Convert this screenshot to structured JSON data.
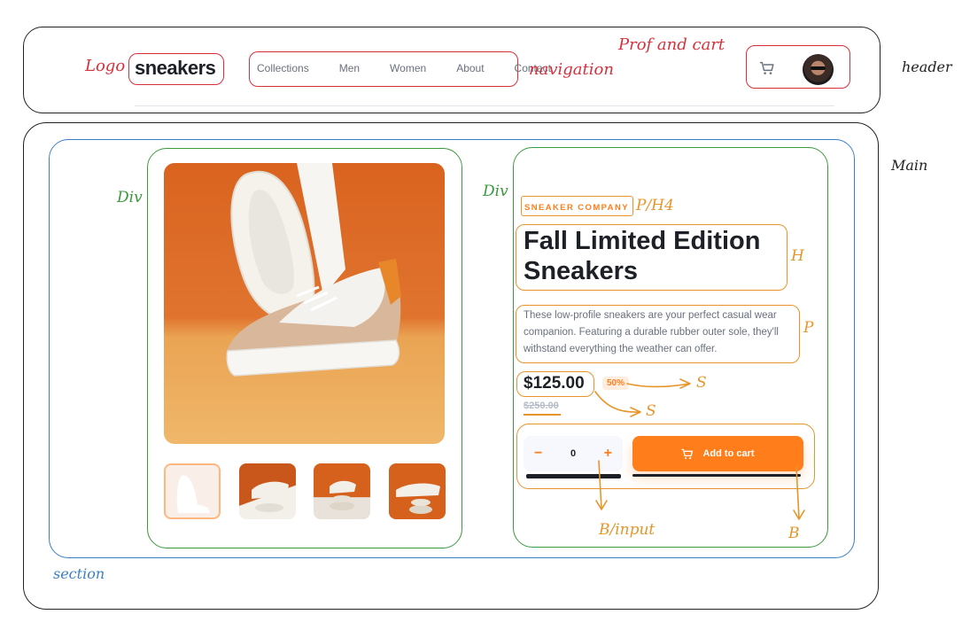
{
  "annotations": {
    "logo": "Logo",
    "navigation": "navigation",
    "prof_and_cart": "Prof and cart",
    "header": "header",
    "main": "Main",
    "section": "section",
    "div_left": "Div",
    "div_right": "Div",
    "p_h4": "P/H4",
    "h": "H",
    "p": "P",
    "s_discount": "S",
    "s_old_price": "S",
    "b_input": "B/input",
    "b": "B"
  },
  "header": {
    "logo": "sneakers",
    "nav": [
      "Collections",
      "Men",
      "Women",
      "About",
      "Contact"
    ],
    "cart_icon": "cart-icon",
    "avatar": "avatar"
  },
  "product": {
    "company": "SNEAKER COMPANY",
    "title": "Fall Limited Edition Sneakers",
    "description": "These low-profile sneakers are your perfect casual wear companion. Featuring a durable rubber outer sole, they'll withstand everything the weather can offer.",
    "price": "$125.00",
    "discount": "50%",
    "original_price": "$250.00",
    "quantity": "0",
    "minus": "−",
    "plus": "+",
    "add_to_cart": "Add to cart"
  },
  "colors": {
    "accent": "#ff7e1b",
    "annotation_red": "#d8303b",
    "annotation_orange": "#e7952a",
    "annotation_green": "#3b9a3d",
    "annotation_blue": "#3b7fc9"
  }
}
